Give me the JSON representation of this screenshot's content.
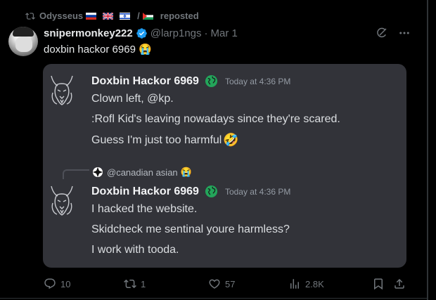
{
  "repost": {
    "user": "Odysseus",
    "label": "reposted",
    "flags": [
      "ru-flag",
      "uk-flag",
      "il-flag",
      "ps-flag"
    ],
    "flag_separator": "/"
  },
  "author": {
    "name": "snipermonkey222",
    "handle": "@larp1ngs",
    "dot": "·",
    "date": "Mar 1"
  },
  "tweet": {
    "text": "doxbin hackor 6969",
    "emoji": "😭"
  },
  "card": {
    "messages": [
      {
        "name": "Doxbin Hackor 6969",
        "time": "Today at 4:36 PM",
        "lines": [
          "Clown left, @kp.",
          ":Rofl Kid's leaving nowadays since they're scared.",
          "Guess I'm just too harmful"
        ],
        "trailing_emoji": "🤣"
      },
      {
        "reply_to": "@canadian asian",
        "reply_emoji": "😭",
        "name": "Doxbin Hackor 6969",
        "time": "Today at 4:36 PM",
        "lines": [
          "I hacked the website.",
          "Skidcheck me sentinal youre harmless?",
          "I work with tooda."
        ]
      }
    ]
  },
  "actions": {
    "replies": "10",
    "reposts": "1",
    "likes": "57",
    "views": "2.8K"
  },
  "colors": {
    "accent_blue": "#1d9bf0",
    "card_bg": "#323339",
    "globe_green": "#23a55a"
  }
}
